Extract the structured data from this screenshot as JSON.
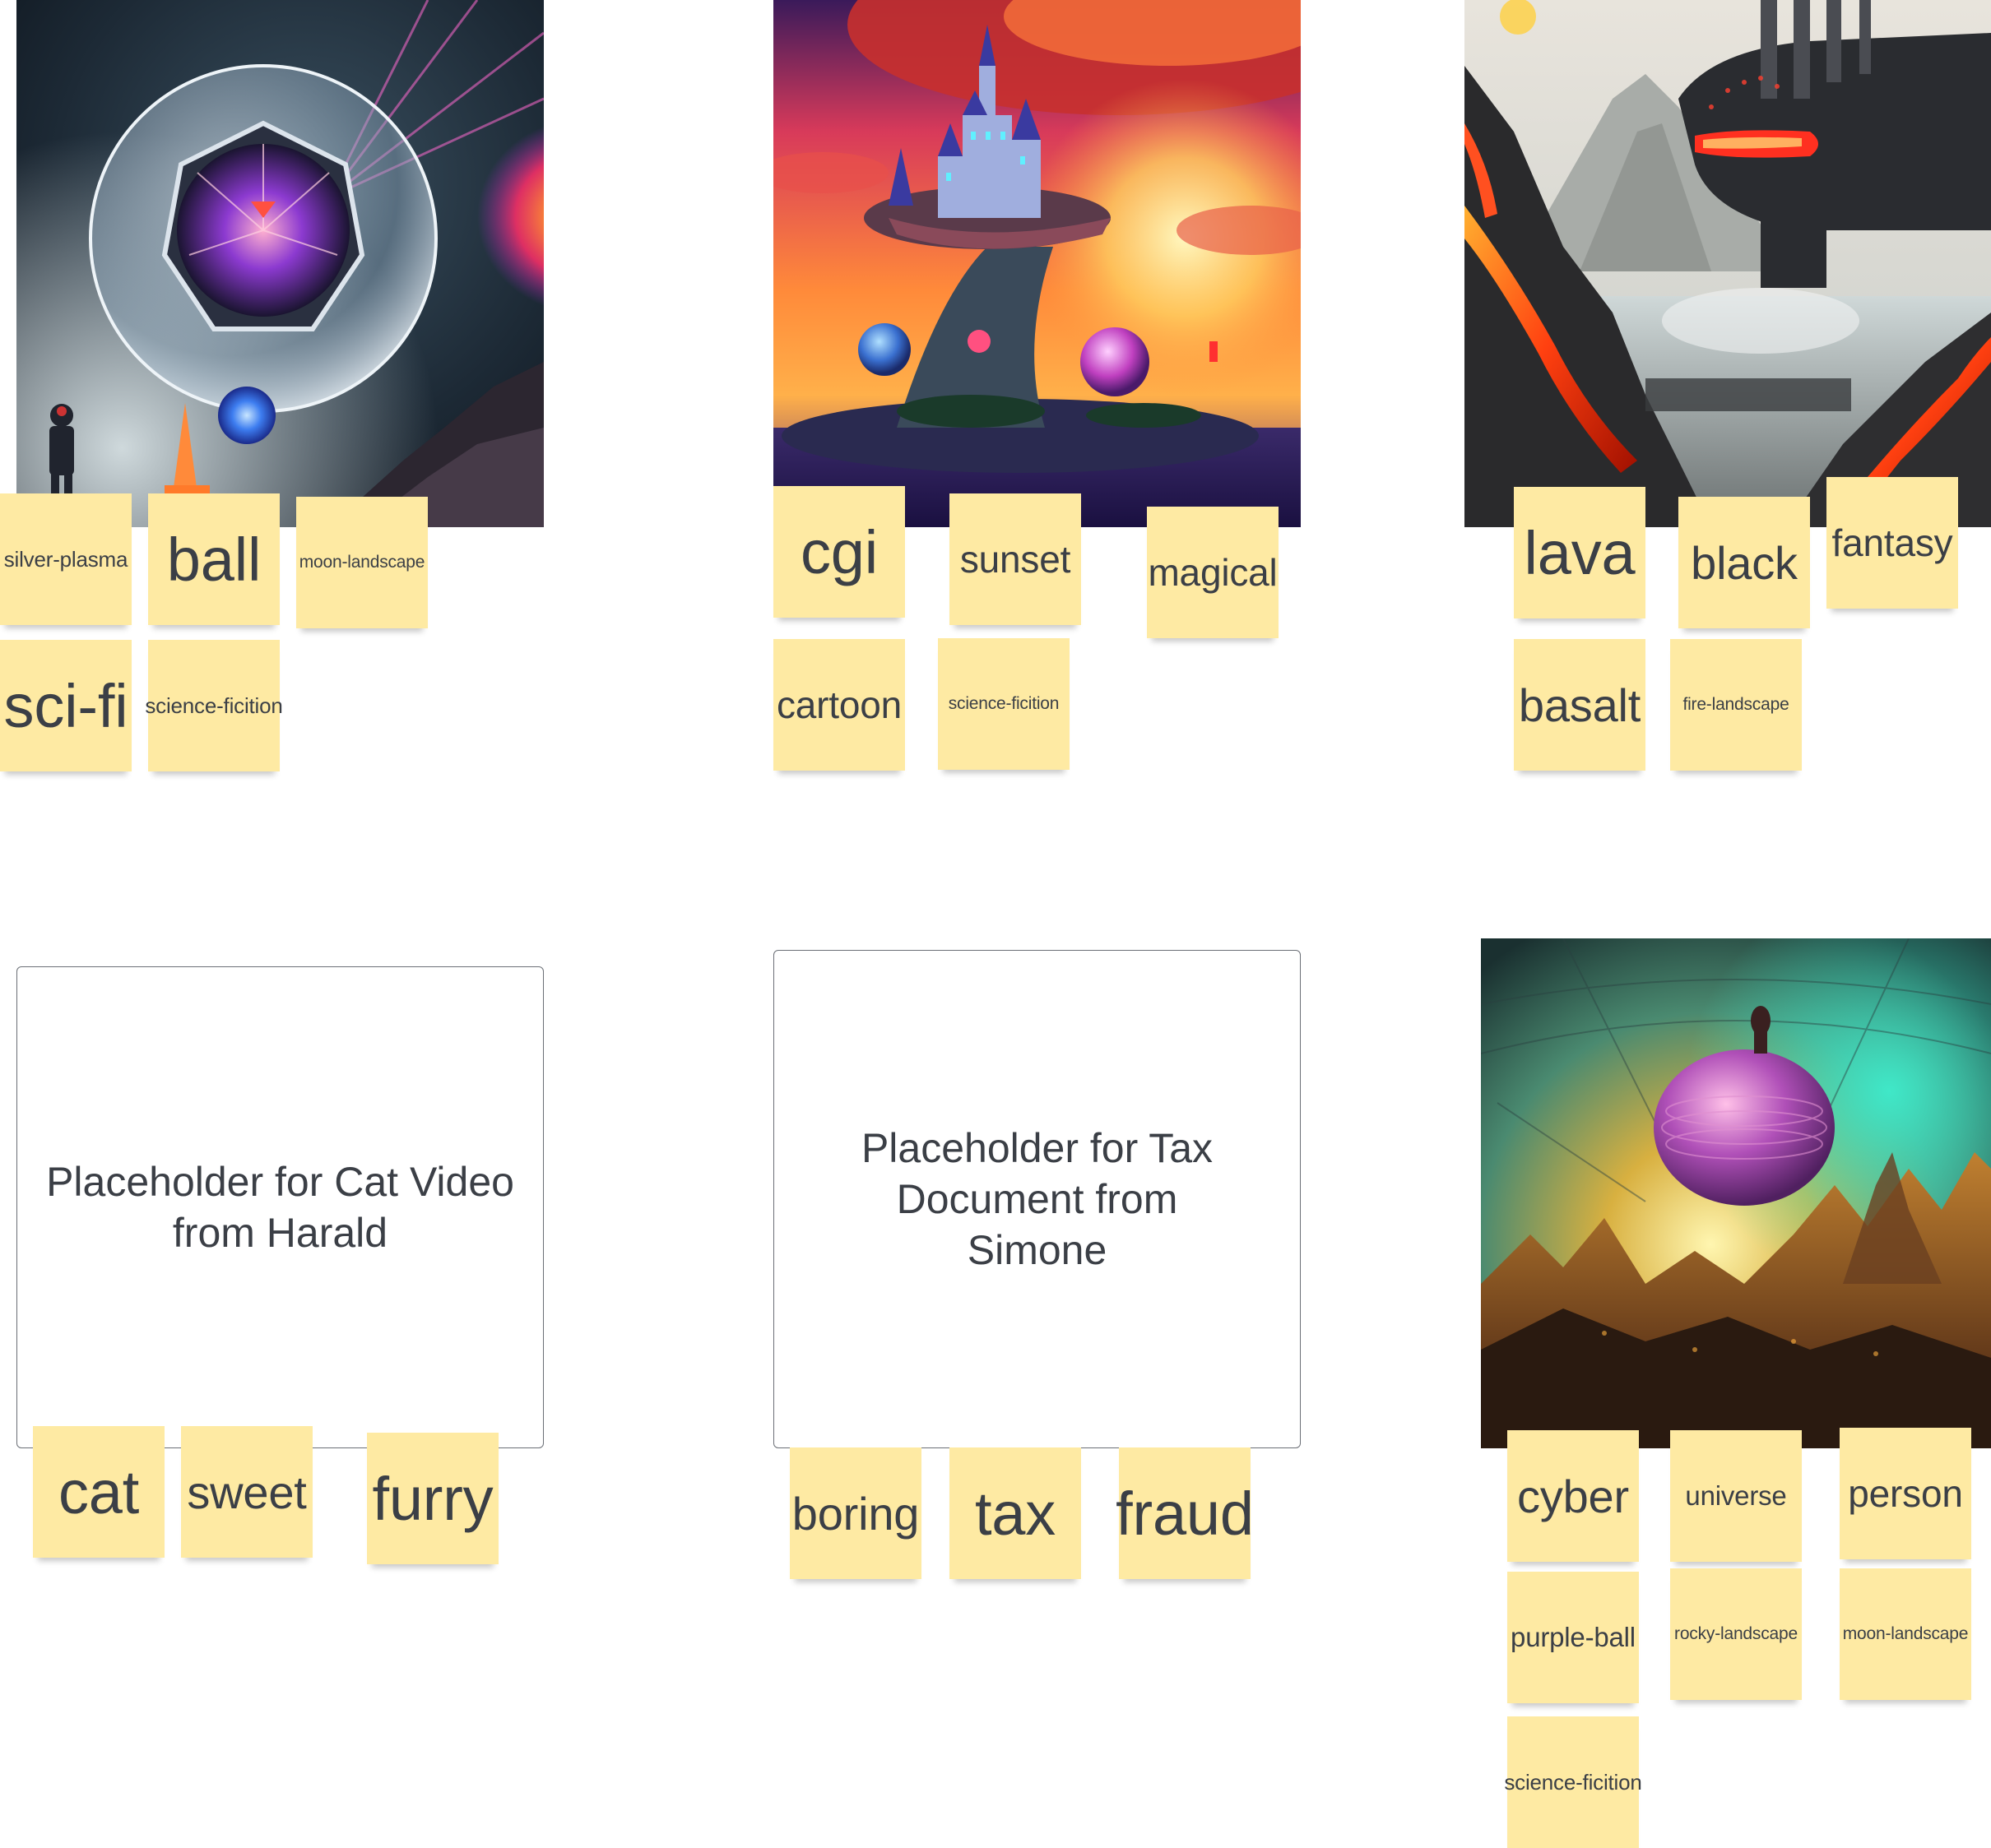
{
  "colors": {
    "sticky_note": "#feeaa3",
    "text": "#3b3f46",
    "placeholder_border": "#6b6f76"
  },
  "images": [
    {
      "name": "glass-sphere-astronaut-image",
      "icon": "sci-fi-sphere-artwork"
    },
    {
      "name": "floating-castle-sunset-image",
      "icon": "fantasy-castle-artwork"
    },
    {
      "name": "lava-spaceship-landscape-image",
      "icon": "lava-landscape-artwork"
    },
    {
      "name": "purple-ball-cyber-landscape-image",
      "icon": "cyber-landscape-artwork"
    }
  ],
  "placeholders": {
    "cat_video": "Placeholder for Cat Video from Harald",
    "tax_document": "Placeholder for Tax Document from Simone"
  },
  "stickies": {
    "group1": [
      "silver-plasma",
      "ball",
      "moon-landscape",
      "sci-fi",
      "science-ficition"
    ],
    "group2": [
      "cgi",
      "sunset",
      "magical",
      "cartoon",
      "science-ficition"
    ],
    "group3": [
      "lava",
      "black",
      "fantasy",
      "basalt",
      "fire-landscape"
    ],
    "group4": [
      "cat",
      "sweet",
      "furry"
    ],
    "group5": [
      "boring",
      "tax",
      "fraud"
    ],
    "group6": [
      "cyber",
      "universe",
      "person",
      "purple-ball",
      "rocky-landscape",
      "moon-landscape",
      "science-ficition"
    ]
  }
}
